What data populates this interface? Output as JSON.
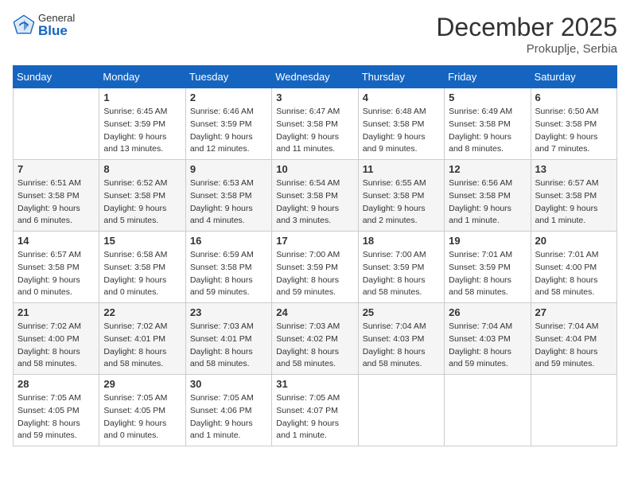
{
  "header": {
    "logo_general": "General",
    "logo_blue": "Blue",
    "month_title": "December 2025",
    "location": "Prokuplje, Serbia"
  },
  "weekdays": [
    "Sunday",
    "Monday",
    "Tuesday",
    "Wednesday",
    "Thursday",
    "Friday",
    "Saturday"
  ],
  "weeks": [
    [
      {
        "day": "",
        "sunrise": "",
        "sunset": "",
        "daylight": ""
      },
      {
        "day": "1",
        "sunrise": "Sunrise: 6:45 AM",
        "sunset": "Sunset: 3:59 PM",
        "daylight": "Daylight: 9 hours and 13 minutes."
      },
      {
        "day": "2",
        "sunrise": "Sunrise: 6:46 AM",
        "sunset": "Sunset: 3:59 PM",
        "daylight": "Daylight: 9 hours and 12 minutes."
      },
      {
        "day": "3",
        "sunrise": "Sunrise: 6:47 AM",
        "sunset": "Sunset: 3:58 PM",
        "daylight": "Daylight: 9 hours and 11 minutes."
      },
      {
        "day": "4",
        "sunrise": "Sunrise: 6:48 AM",
        "sunset": "Sunset: 3:58 PM",
        "daylight": "Daylight: 9 hours and 9 minutes."
      },
      {
        "day": "5",
        "sunrise": "Sunrise: 6:49 AM",
        "sunset": "Sunset: 3:58 PM",
        "daylight": "Daylight: 9 hours and 8 minutes."
      },
      {
        "day": "6",
        "sunrise": "Sunrise: 6:50 AM",
        "sunset": "Sunset: 3:58 PM",
        "daylight": "Daylight: 9 hours and 7 minutes."
      }
    ],
    [
      {
        "day": "7",
        "sunrise": "Sunrise: 6:51 AM",
        "sunset": "Sunset: 3:58 PM",
        "daylight": "Daylight: 9 hours and 6 minutes."
      },
      {
        "day": "8",
        "sunrise": "Sunrise: 6:52 AM",
        "sunset": "Sunset: 3:58 PM",
        "daylight": "Daylight: 9 hours and 5 minutes."
      },
      {
        "day": "9",
        "sunrise": "Sunrise: 6:53 AM",
        "sunset": "Sunset: 3:58 PM",
        "daylight": "Daylight: 9 hours and 4 minutes."
      },
      {
        "day": "10",
        "sunrise": "Sunrise: 6:54 AM",
        "sunset": "Sunset: 3:58 PM",
        "daylight": "Daylight: 9 hours and 3 minutes."
      },
      {
        "day": "11",
        "sunrise": "Sunrise: 6:55 AM",
        "sunset": "Sunset: 3:58 PM",
        "daylight": "Daylight: 9 hours and 2 minutes."
      },
      {
        "day": "12",
        "sunrise": "Sunrise: 6:56 AM",
        "sunset": "Sunset: 3:58 PM",
        "daylight": "Daylight: 9 hours and 1 minute."
      },
      {
        "day": "13",
        "sunrise": "Sunrise: 6:57 AM",
        "sunset": "Sunset: 3:58 PM",
        "daylight": "Daylight: 9 hours and 1 minute."
      }
    ],
    [
      {
        "day": "14",
        "sunrise": "Sunrise: 6:57 AM",
        "sunset": "Sunset: 3:58 PM",
        "daylight": "Daylight: 9 hours and 0 minutes."
      },
      {
        "day": "15",
        "sunrise": "Sunrise: 6:58 AM",
        "sunset": "Sunset: 3:58 PM",
        "daylight": "Daylight: 9 hours and 0 minutes."
      },
      {
        "day": "16",
        "sunrise": "Sunrise: 6:59 AM",
        "sunset": "Sunset: 3:58 PM",
        "daylight": "Daylight: 8 hours and 59 minutes."
      },
      {
        "day": "17",
        "sunrise": "Sunrise: 7:00 AM",
        "sunset": "Sunset: 3:59 PM",
        "daylight": "Daylight: 8 hours and 59 minutes."
      },
      {
        "day": "18",
        "sunrise": "Sunrise: 7:00 AM",
        "sunset": "Sunset: 3:59 PM",
        "daylight": "Daylight: 8 hours and 58 minutes."
      },
      {
        "day": "19",
        "sunrise": "Sunrise: 7:01 AM",
        "sunset": "Sunset: 3:59 PM",
        "daylight": "Daylight: 8 hours and 58 minutes."
      },
      {
        "day": "20",
        "sunrise": "Sunrise: 7:01 AM",
        "sunset": "Sunset: 4:00 PM",
        "daylight": "Daylight: 8 hours and 58 minutes."
      }
    ],
    [
      {
        "day": "21",
        "sunrise": "Sunrise: 7:02 AM",
        "sunset": "Sunset: 4:00 PM",
        "daylight": "Daylight: 8 hours and 58 minutes."
      },
      {
        "day": "22",
        "sunrise": "Sunrise: 7:02 AM",
        "sunset": "Sunset: 4:01 PM",
        "daylight": "Daylight: 8 hours and 58 minutes."
      },
      {
        "day": "23",
        "sunrise": "Sunrise: 7:03 AM",
        "sunset": "Sunset: 4:01 PM",
        "daylight": "Daylight: 8 hours and 58 minutes."
      },
      {
        "day": "24",
        "sunrise": "Sunrise: 7:03 AM",
        "sunset": "Sunset: 4:02 PM",
        "daylight": "Daylight: 8 hours and 58 minutes."
      },
      {
        "day": "25",
        "sunrise": "Sunrise: 7:04 AM",
        "sunset": "Sunset: 4:03 PM",
        "daylight": "Daylight: 8 hours and 58 minutes."
      },
      {
        "day": "26",
        "sunrise": "Sunrise: 7:04 AM",
        "sunset": "Sunset: 4:03 PM",
        "daylight": "Daylight: 8 hours and 59 minutes."
      },
      {
        "day": "27",
        "sunrise": "Sunrise: 7:04 AM",
        "sunset": "Sunset: 4:04 PM",
        "daylight": "Daylight: 8 hours and 59 minutes."
      }
    ],
    [
      {
        "day": "28",
        "sunrise": "Sunrise: 7:05 AM",
        "sunset": "Sunset: 4:05 PM",
        "daylight": "Daylight: 8 hours and 59 minutes."
      },
      {
        "day": "29",
        "sunrise": "Sunrise: 7:05 AM",
        "sunset": "Sunset: 4:05 PM",
        "daylight": "Daylight: 9 hours and 0 minutes."
      },
      {
        "day": "30",
        "sunrise": "Sunrise: 7:05 AM",
        "sunset": "Sunset: 4:06 PM",
        "daylight": "Daylight: 9 hours and 1 minute."
      },
      {
        "day": "31",
        "sunrise": "Sunrise: 7:05 AM",
        "sunset": "Sunset: 4:07 PM",
        "daylight": "Daylight: 9 hours and 1 minute."
      },
      {
        "day": "",
        "sunrise": "",
        "sunset": "",
        "daylight": ""
      },
      {
        "day": "",
        "sunrise": "",
        "sunset": "",
        "daylight": ""
      },
      {
        "day": "",
        "sunrise": "",
        "sunset": "",
        "daylight": ""
      }
    ]
  ]
}
